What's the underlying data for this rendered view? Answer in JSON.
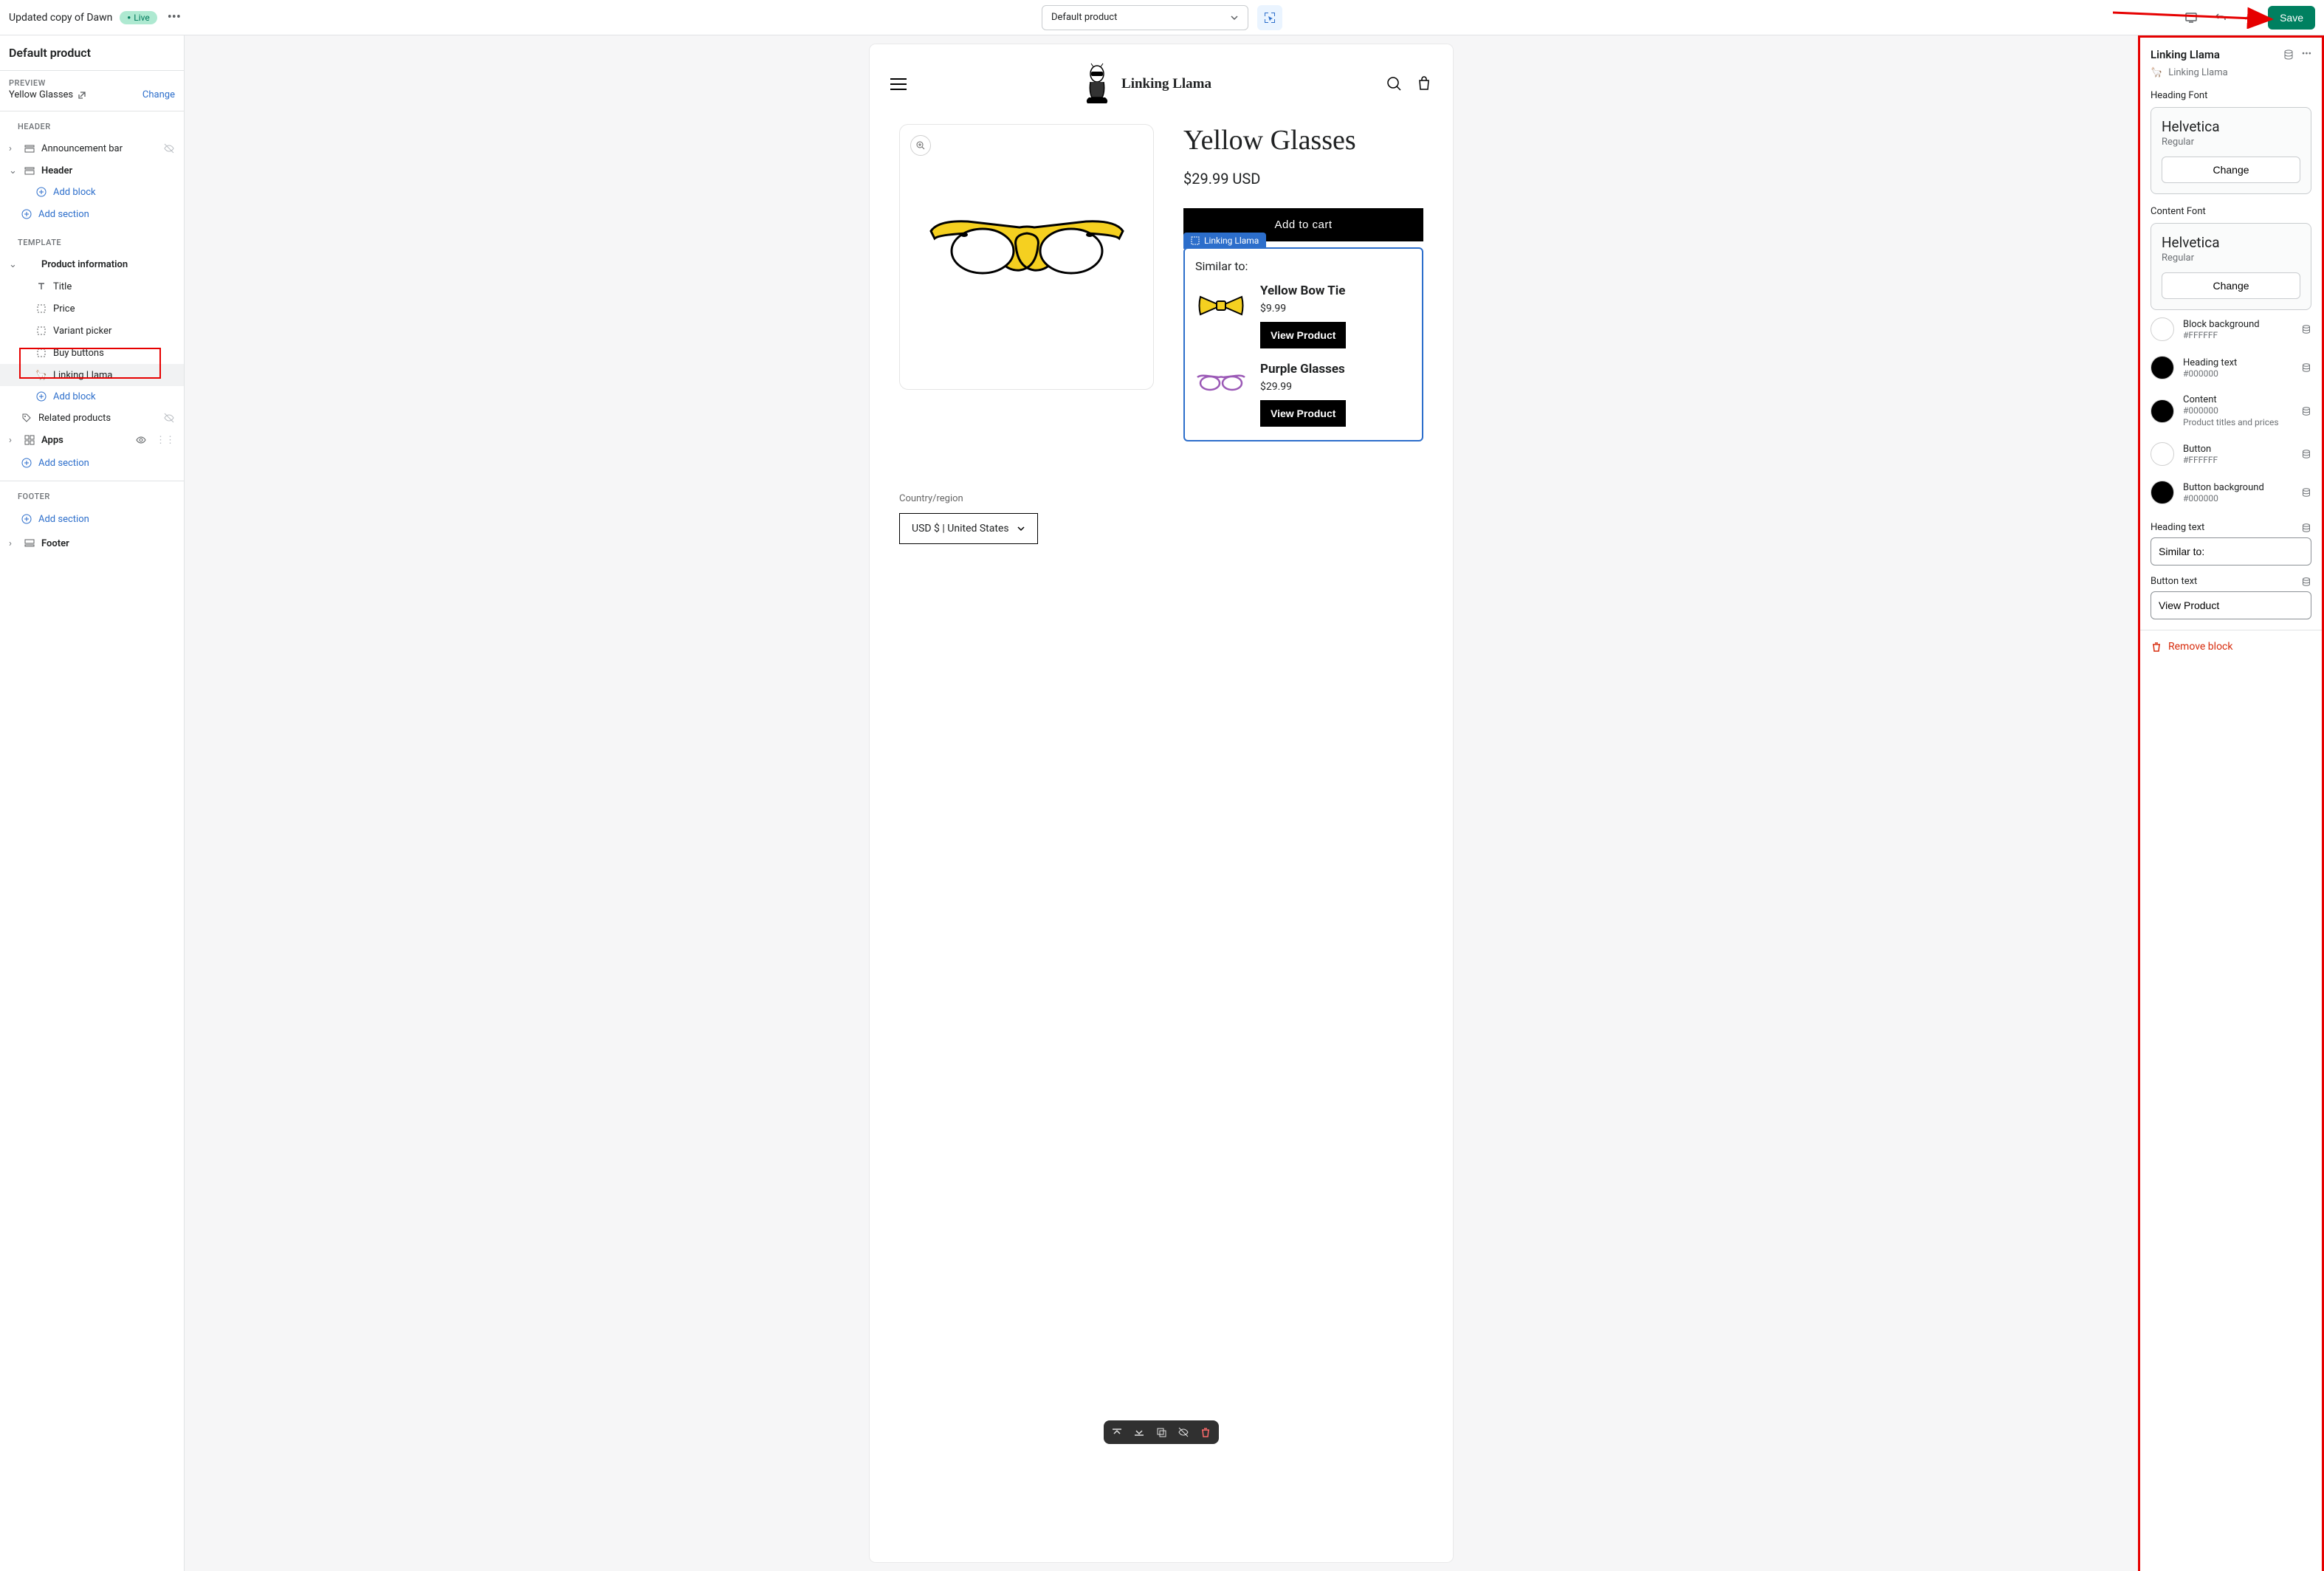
{
  "topbar": {
    "theme_name": "Updated copy of Dawn",
    "live_badge": "Live",
    "template_selected": "Default product",
    "save_label": "Save"
  },
  "left_sidebar": {
    "title": "Default product",
    "preview_label": "PREVIEW",
    "preview_product": "Yellow Glasses",
    "change_link": "Change",
    "header_group": "HEADER",
    "announcement_bar": "Announcement bar",
    "header": "Header",
    "add_block": "Add block",
    "add_section": "Add section",
    "template_group": "TEMPLATE",
    "product_information": "Product information",
    "title_item": "Title",
    "price_item": "Price",
    "variant_picker": "Variant picker",
    "buy_buttons": "Buy buttons",
    "linking_llama": "Linking Llama",
    "related_products": "Related products",
    "apps": "Apps",
    "footer_group": "FOOTER",
    "footer": "Footer"
  },
  "preview": {
    "store_name": "Linking Llama",
    "product_title": "Yellow Glasses",
    "product_price": "$29.99 USD",
    "add_to_cart": "Add to cart",
    "linking_tag": "Linking Llama",
    "similar_to": "Similar to:",
    "related": [
      {
        "title": "Yellow Bow Tie",
        "price": "$9.99",
        "button": "View Product"
      },
      {
        "title": "Purple Glasses",
        "price": "$29.99",
        "button": "View Product"
      }
    ],
    "region_label": "Country/region",
    "region_value": "USD $ | United States"
  },
  "right_sidebar": {
    "title": "Linking Llama",
    "subtitle": "Linking Llama",
    "heading_font_label": "Heading Font",
    "content_font_label": "Content Font",
    "font_name": "Helvetica",
    "font_variant": "Regular",
    "change_btn": "Change",
    "colors": [
      {
        "name": "Block background",
        "hex": "#FFFFFF",
        "swatch": "#ffffff"
      },
      {
        "name": "Heading text",
        "hex": "#000000",
        "swatch": "#000000"
      },
      {
        "name": "Content",
        "hex": "#000000",
        "swatch": "#000000",
        "desc": "Product titles and prices"
      },
      {
        "name": "Button",
        "hex": "#FFFFFF",
        "swatch": "#ffffff"
      },
      {
        "name": "Button background",
        "hex": "#000000",
        "swatch": "#000000"
      }
    ],
    "heading_text_label": "Heading text",
    "heading_text_value": "Similar to:",
    "button_text_label": "Button text",
    "button_text_value": "View Product",
    "remove_block": "Remove block"
  }
}
